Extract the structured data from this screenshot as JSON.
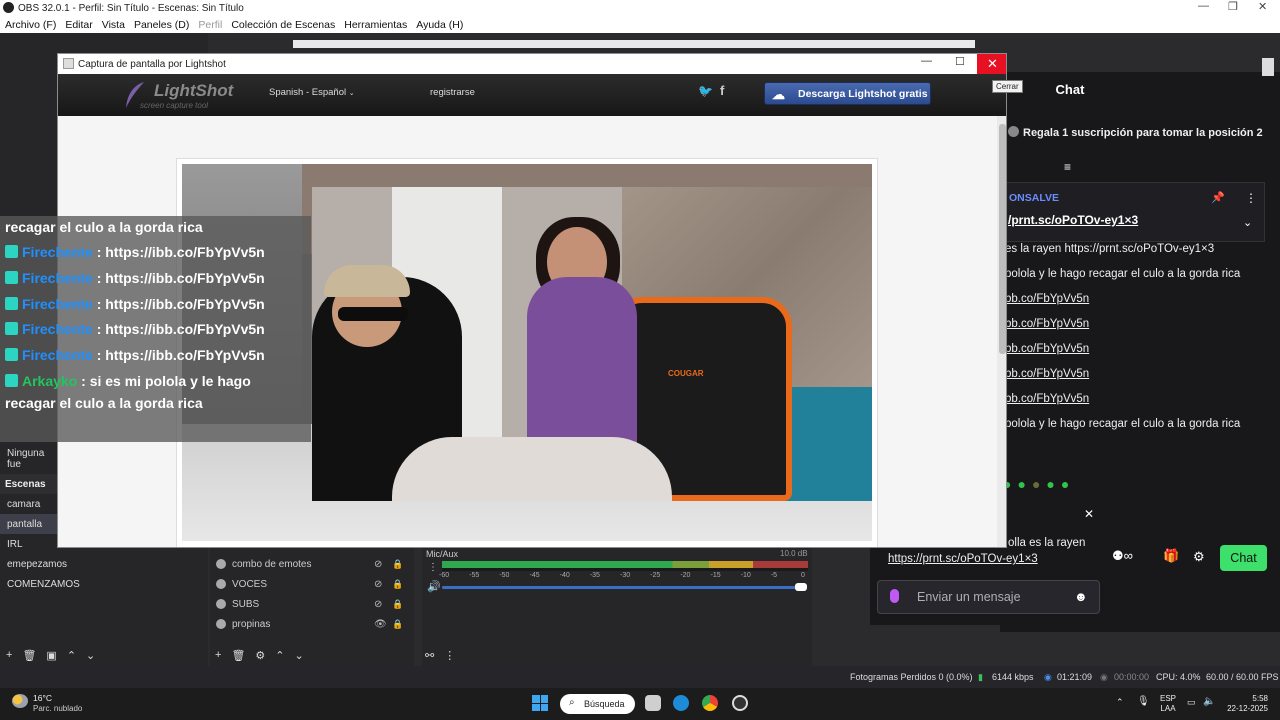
{
  "obs": {
    "title": "OBS 32.0.1 - Perfil: Sin Título - Escenas: Sin Título",
    "menu": [
      "Archivo (F)",
      "Editar",
      "Vista",
      "Paneles (D)",
      "Perfil",
      "Colección de Escenas",
      "Herramientas",
      "Ayuda (H)"
    ],
    "no_source": "Ninguna fue",
    "scenes_header": "Escenas",
    "scenes": [
      "camara",
      "pantalla",
      "IRL",
      "emepezamos",
      "COMENZAMOS"
    ],
    "selected_scene": "pantalla",
    "sources": [
      "combo de emotes",
      "VOCES",
      "SUBS",
      "propinas"
    ],
    "mixer": {
      "label": "Mic/Aux",
      "db": "10.0 dB",
      "ticks": [
        "-60",
        "-55",
        "-50",
        "-45",
        "-40",
        "-35",
        "-30",
        "-25",
        "-20",
        "-15",
        "-10",
        "-5",
        "0"
      ]
    },
    "status": {
      "dropped": "Fotogramas Perdidos 0 (0.0%)",
      "bitrate": "6144 kbps",
      "live_time": "01:21:09",
      "rec_time": "00:00:00",
      "cpu": "CPU: 4.0%",
      "fps": "60.00 / 60.00 FPS"
    }
  },
  "lightshot": {
    "window_title": "Captura de pantalla por Lightshot",
    "close_tooltip": "Cerrar",
    "logo": "LightShot",
    "logo_sub": "screen capture tool",
    "language": "Spanish - Español",
    "register": "registrarse",
    "download": "Descarga Lightshot gratis",
    "chair_brand": "COUGAR"
  },
  "overlay_chat": [
    {
      "user": "",
      "text": "recagar el culo a la gorda rica"
    },
    {
      "user": "Firechente",
      "text": ": https://ibb.co/FbYpVv5n"
    },
    {
      "user": "Firechente",
      "text": ": https://ibb.co/FbYpVv5n"
    },
    {
      "user": "Firechente",
      "text": ": https://ibb.co/FbYpVv5n"
    },
    {
      "user": "Firechente",
      "text": ": https://ibb.co/FbYpVv5n"
    },
    {
      "user": "Firechente",
      "text": ": https://ibb.co/FbYpVv5n"
    },
    {
      "user": "Arkayko",
      "text": ": si es mi polola y le hago"
    },
    {
      "user": "",
      "text": "recagar el culo a la gorda rica"
    }
  ],
  "twitch": {
    "title": "Chat",
    "gift_banner": "Regala 1 suscripción para tomar la posición 2",
    "pinned_name": "ONSALVE",
    "pinned_link": "/prnt.sc/oPoTOv-ey1×3",
    "lines": [
      "es la rayen https://prnt.sc/oPoTOv-ey1×3",
      "polola y le hago recagar el culo a la gorda rica",
      "bb.co/FbYpVv5n",
      "bb.co/FbYpVv5n",
      "bb.co/FbYpVv5n",
      "bb.co/FbYpVv5n",
      "bb.co/FbYpVv5n",
      "polola y le hago recagar el culo a la gorda rica"
    ],
    "popup_line1": "olla es la rayen",
    "popup_line2": "https://prnt.sc/oPoTOv-ey1×3",
    "input_placeholder": "Enviar un mensaje",
    "send": "Chat"
  },
  "taskbar": {
    "temp": "16°C",
    "weather": "Parc. nublado",
    "search": "Búsqueda",
    "lang1": "ESP",
    "lang2": "LAA",
    "time": "5:58",
    "date": "22-12-2025"
  }
}
